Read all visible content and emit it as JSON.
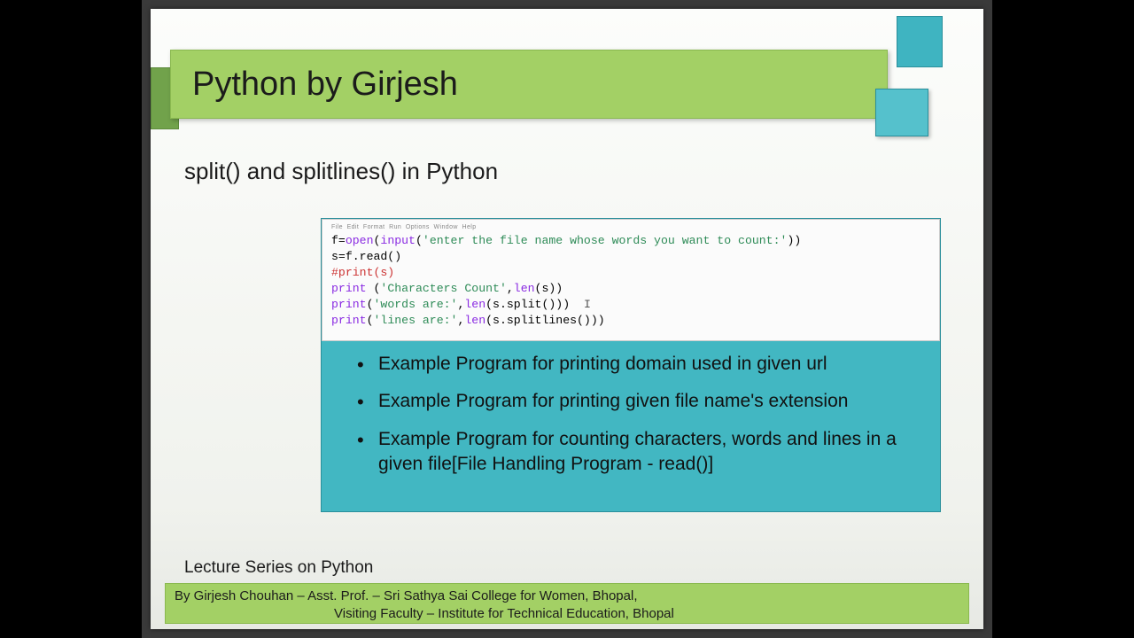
{
  "title": "Python by Girjesh",
  "subtitle": "split() and splitlines() in Python",
  "code": {
    "menubar": "File  Edit  Format  Run  Options  Window  Help",
    "l1_pre": "f=",
    "l1_fn1": "open",
    "l1_mid": "(",
    "l1_fn2": "input",
    "l1_open": "(",
    "l1_str": "'enter the file name whose words you want to count:'",
    "l1_end": "))",
    "l2": "s=f.read()",
    "l3": "#print(s)",
    "l4_fn": "print",
    "l4_mid": " (",
    "l4_str": "'Characters Count'",
    "l4_rest": ",",
    "l4_len": "len",
    "l4_end": "(s))",
    "l5_fn": "print",
    "l5_open": "(",
    "l5_str": "'words are:'",
    "l5_rest": ",",
    "l5_len": "len",
    "l5_end": "(s.split()))",
    "l6_fn": "print",
    "l6_open": "(",
    "l6_str": "'lines are:'",
    "l6_rest": ",",
    "l6_len": "len",
    "l6_end": "(s.splitlines()))",
    "cursor": "I"
  },
  "bullets": [
    "Example Program for printing domain used in given url",
    "Example Program for printing given file name's extension",
    "Example Program for counting characters, words and lines in a given file[File Handling Program - read()]"
  ],
  "series": "Lecture Series on Python",
  "footer": {
    "line1": "By Girjesh Chouhan – Asst. Prof. – Sri Sathya Sai College for Women, Bhopal,",
    "line2": "Visiting Faculty – Institute for Technical Education, Bhopal"
  }
}
